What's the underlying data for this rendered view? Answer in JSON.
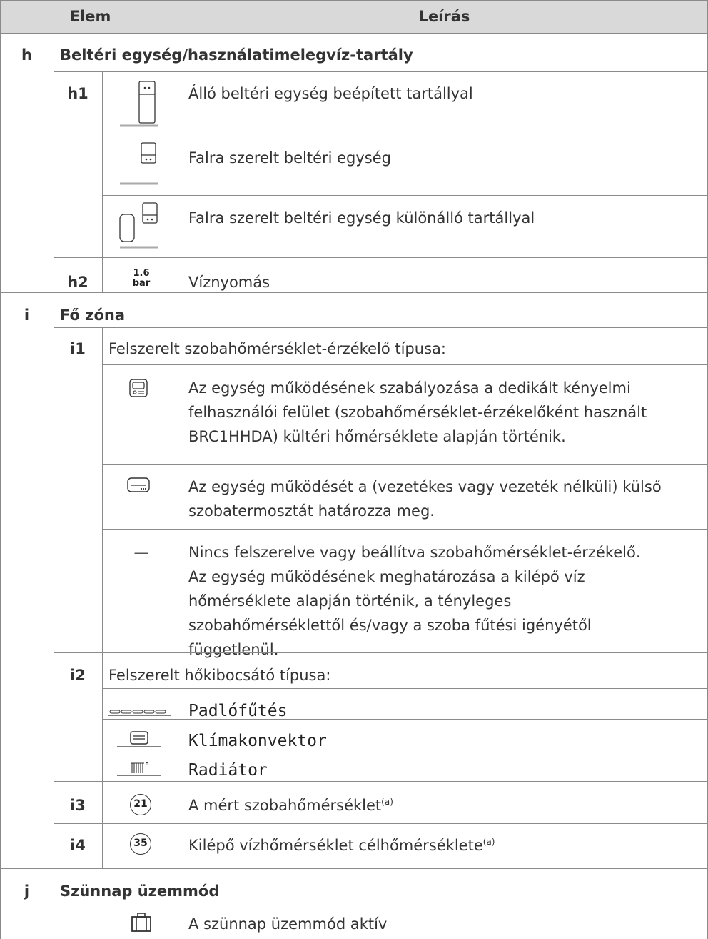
{
  "header": {
    "col1": "Elem",
    "col2": "Leírás"
  },
  "h": {
    "letter": "h",
    "title": "Beltéri egység/használatimelegvíz-tartály",
    "h1": {
      "id": "h1",
      "rows": [
        {
          "icon": "floor-standing-indoor-unit-icon",
          "text": "Álló beltéri egység beépített tartállyal"
        },
        {
          "icon": "wall-mounted-indoor-unit-icon",
          "text": "Falra szerelt beltéri egység"
        },
        {
          "icon": "wall-mounted-with-tank-icon",
          "text": "Falra szerelt beltéri egység különálló tartállyal"
        }
      ]
    },
    "h2": {
      "id": "h2",
      "icon_top": "1.6",
      "icon_bottom": "bar",
      "text": "Víznyomás"
    }
  },
  "i": {
    "letter": "i",
    "title": "Fő zóna",
    "i1": {
      "id": "i1",
      "title": "Felszerelt szobahőmérséklet-érzékelő típusa:",
      "rows": [
        {
          "icon": "user-interface-sensor-icon",
          "lines": [
            "Az egység működésének szabályozása a dedikált kényelmi",
            "felhasználói felület (szobahőmérséklet-érzékelőként használt",
            "BRC1HHDA) kültéri hőmérséklete alapján történik."
          ]
        },
        {
          "icon": "external-thermostat-icon",
          "lines": [
            "Az egység működését a (vezetékes vagy vezeték nélküli) külső",
            "szobatermosztát határozza meg."
          ]
        },
        {
          "icon_text": "—",
          "lines": [
            "Nincs felszerelve vagy beállítva szobahőmérséklet-érzékelő.",
            "Az egység működésének meghatározása a kilépő víz",
            "hőmérséklete alapján történik, a tényleges",
            "szobahőmérséklettől és/vagy a szoba fűtési igényétől",
            "függetlenül."
          ]
        }
      ]
    },
    "i2": {
      "id": "i2",
      "title": "Felszerelt hőkibocsátó típusa:",
      "rows": [
        {
          "icon": "underfloor-heating-icon",
          "text": "Padlófűtés"
        },
        {
          "icon": "fan-coil-unit-icon",
          "text": "Klímakonvektor"
        },
        {
          "icon": "radiator-icon",
          "text": "Radiátor"
        }
      ]
    },
    "i3": {
      "id": "i3",
      "icon_value": "21",
      "text": "A mért szobahőmérséklet",
      "note": "(a)"
    },
    "i4": {
      "id": "i4",
      "icon_value": "35",
      "text": "Kilépő vízhőmérséklet célhőmérséklete",
      "note": "(a)"
    }
  },
  "j": {
    "letter": "j",
    "title": "Szünnap üzemmód",
    "rows": [
      {
        "icon": "holiday-suitcase-icon",
        "text": "A szünnap üzemmód aktív"
      }
    ]
  }
}
